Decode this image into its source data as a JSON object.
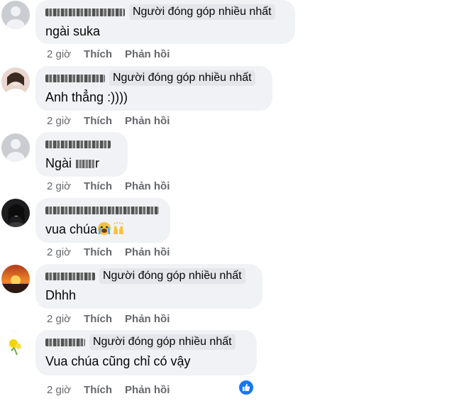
{
  "badge_label": "Người đóng góp nhiều nhất",
  "actions": {
    "time": "2 giờ",
    "like": "Thích",
    "reply": "Phản hồi"
  },
  "comments": [
    {
      "text": "ngài suka",
      "has_badge": true,
      "avatar": "default-avatar"
    },
    {
      "text": "Anh thẳng :))))",
      "has_badge": true,
      "avatar": "photo-avatar"
    },
    {
      "text_prefix": "Ngài ",
      "text_suffix": "r",
      "has_badge": false,
      "avatar": "default-avatar"
    },
    {
      "text": "vua chúa",
      "has_badge": false,
      "avatar": "photo-avatar",
      "emojis": [
        "crying-face-emoji",
        "raised-hands-emoji"
      ]
    },
    {
      "text": "Dhhh",
      "has_badge": true,
      "avatar": "sunset-avatar"
    },
    {
      "text": "Vua chúa cũng chỉ có vậy",
      "has_badge": true,
      "avatar": "flower-avatar"
    }
  ],
  "reaction_icon": "like-reaction-icon",
  "colors": {
    "bubble": "#f0f2f5",
    "badge": "#e4e6eb",
    "meta": "#65676b",
    "like_blue": "#1877f2"
  }
}
